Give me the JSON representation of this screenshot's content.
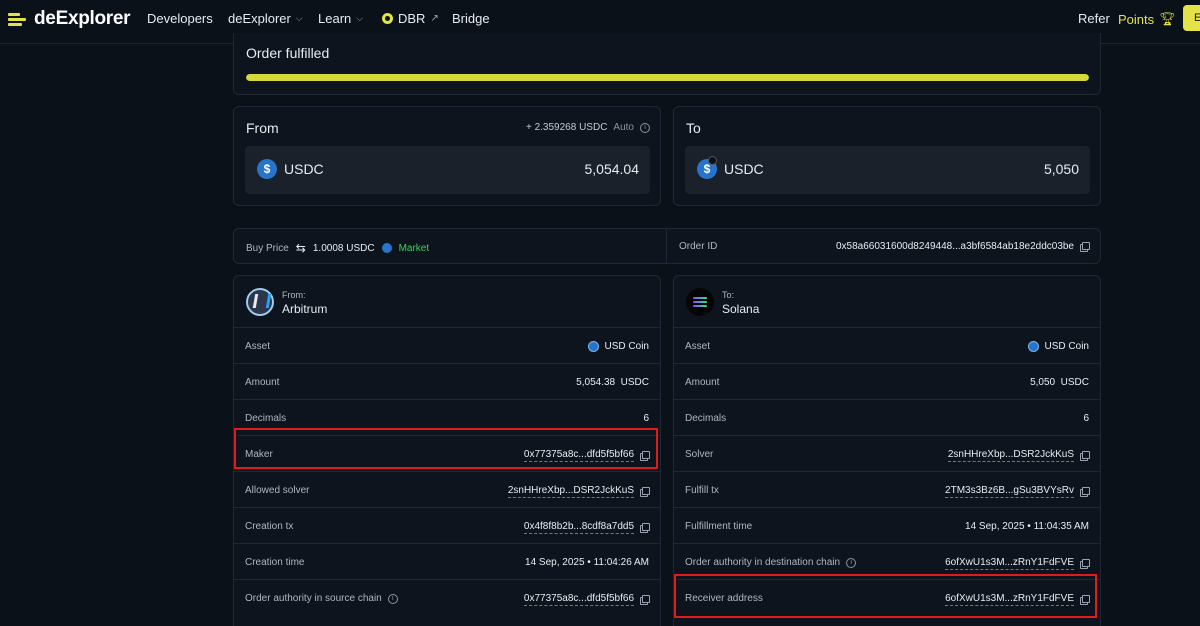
{
  "nav": {
    "brand": "deExplorer",
    "items": [
      {
        "label": "Developers"
      },
      {
        "label": "deExplorer"
      },
      {
        "label": "Learn"
      },
      {
        "label": "DBR"
      },
      {
        "label": "Bridge"
      }
    ],
    "refer": "Refer",
    "points": "Points",
    "cta": "E"
  },
  "order": {
    "status": "Order fulfilled",
    "progress_percent": 100
  },
  "from_card": {
    "title": "From",
    "extra_amount": "+ 2.359268 USDC",
    "mode": "Auto",
    "token": "USDC",
    "amount": "5,054.04"
  },
  "to_card": {
    "title": "To",
    "token": "USDC",
    "amount": "5,050"
  },
  "info_row": {
    "buy_price_label": "Buy Price",
    "buy_price_value": "1.0008 USDC",
    "market_label": "Market",
    "order_id_label": "Order ID",
    "order_id_value": "0x58a66031600d8249448...a3bf6584ab18e2ddc03be"
  },
  "source": {
    "direction": "From:",
    "chain": "Arbitrum",
    "rows": [
      {
        "label": "Asset",
        "value": "USD Coin"
      },
      {
        "label": "Amount",
        "value": "5,054.38  USDC"
      },
      {
        "label": "Decimals",
        "value": "6"
      },
      {
        "label": "Maker",
        "value": "0x77375a8c...dfd5f5bf66"
      },
      {
        "label": "Allowed solver",
        "value": "2snHHreXbp...DSR2JckKuS"
      },
      {
        "label": "Creation tx",
        "value": "0x4f8f8b2b...8cdf8a7dd5"
      },
      {
        "label": "Creation time",
        "value": "14 Sep, 2025 • 11:04:26 AM"
      },
      {
        "label": "Order authority in source chain",
        "value": "0x77375a8c...dfd5f5bf66"
      }
    ]
  },
  "destination": {
    "direction": "To:",
    "chain": "Solana",
    "rows": [
      {
        "label": "Asset",
        "value": "USD Coin"
      },
      {
        "label": "Amount",
        "value": "5,050  USDC"
      },
      {
        "label": "Decimals",
        "value": "6"
      },
      {
        "label": "Solver",
        "value": "2snHHreXbp...DSR2JckKuS"
      },
      {
        "label": "Fulfill tx",
        "value": "2TM3s3Bz6B...gSu3BVYsRv"
      },
      {
        "label": "Fulfillment time",
        "value": "14 Sep, 2025 • 11:04:35 AM"
      },
      {
        "label": "Order authority in destination chain",
        "value": "6ofXwU1s3M...zRnY1FdFVE"
      },
      {
        "label": "Receiver address",
        "value": "6ofXwU1s3M...zRnY1FdFVE"
      }
    ]
  },
  "colors": {
    "accent": "#e3e347",
    "market": "#3ecf5b",
    "highlight": "#e01b1b",
    "background": "#0b1119"
  }
}
